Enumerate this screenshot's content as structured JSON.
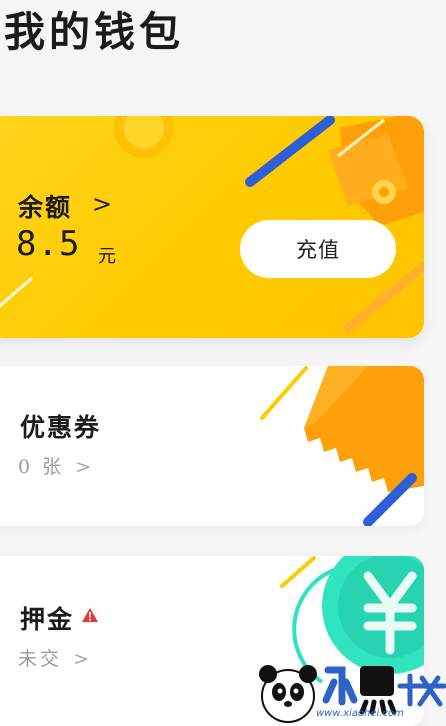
{
  "page": {
    "title": "我的钱包"
  },
  "balance": {
    "label": "余额",
    "chevron": ">",
    "amount": "8.5",
    "unit": "元",
    "recharge_label": "充值"
  },
  "coupon": {
    "title": "优惠券",
    "count_text": "0 张",
    "chevron": ">"
  },
  "deposit": {
    "title": "押金",
    "status_text": "未交",
    "chevron": ">",
    "warning_icon": "warning-triangle-icon"
  },
  "watermark": {
    "brand": "小黑游戏",
    "url": "www.xiaohei.com"
  },
  "colors": {
    "background": "#f6f6f6",
    "balance_card": "#ffcb00",
    "accent_orange": "#ff9f0a",
    "accent_blue": "#2f5fd6",
    "accent_teal": "#2ee6c0",
    "text_secondary": "#9a9a9a",
    "warning_red": "#e53935"
  }
}
